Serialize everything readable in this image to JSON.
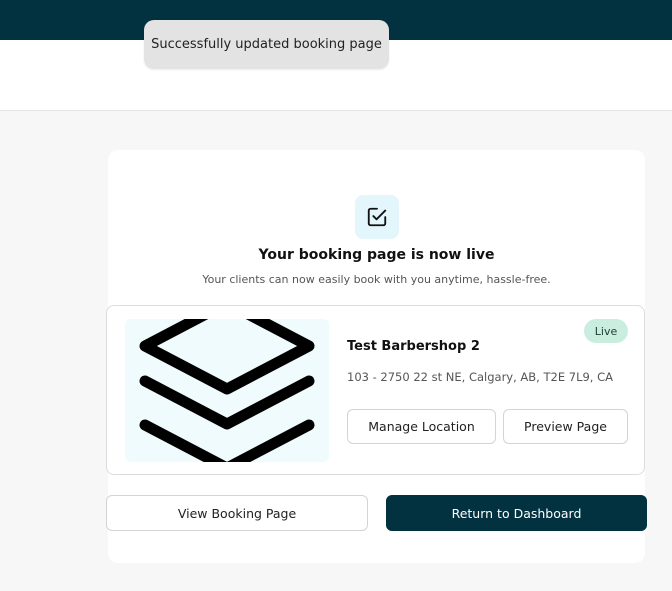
{
  "toast": {
    "message": "Successfully updated booking page"
  },
  "success": {
    "icon": "checkbox-check-icon",
    "heading": "Your booking page is now live",
    "subtext": "Your clients can now easily book with you anytime, hassle-free."
  },
  "location": {
    "thumbnail_icon": "layers-icon",
    "status": "Live",
    "name": "Test Barbershop 2",
    "address": "103 - 2750 22 st NE, Calgary, AB, T2E 7L9, CA",
    "manage_label": "Manage Location",
    "preview_label": "Preview Page"
  },
  "actions": {
    "view_label": "View Booking Page",
    "dashboard_label": "Return to Dashboard"
  },
  "colors": {
    "brand_dark": "#02313f",
    "live_badge_bg": "#c9eee0",
    "icon_tile_bg": "#e3f6fb",
    "thumbnail_bg": "#effbfc"
  }
}
